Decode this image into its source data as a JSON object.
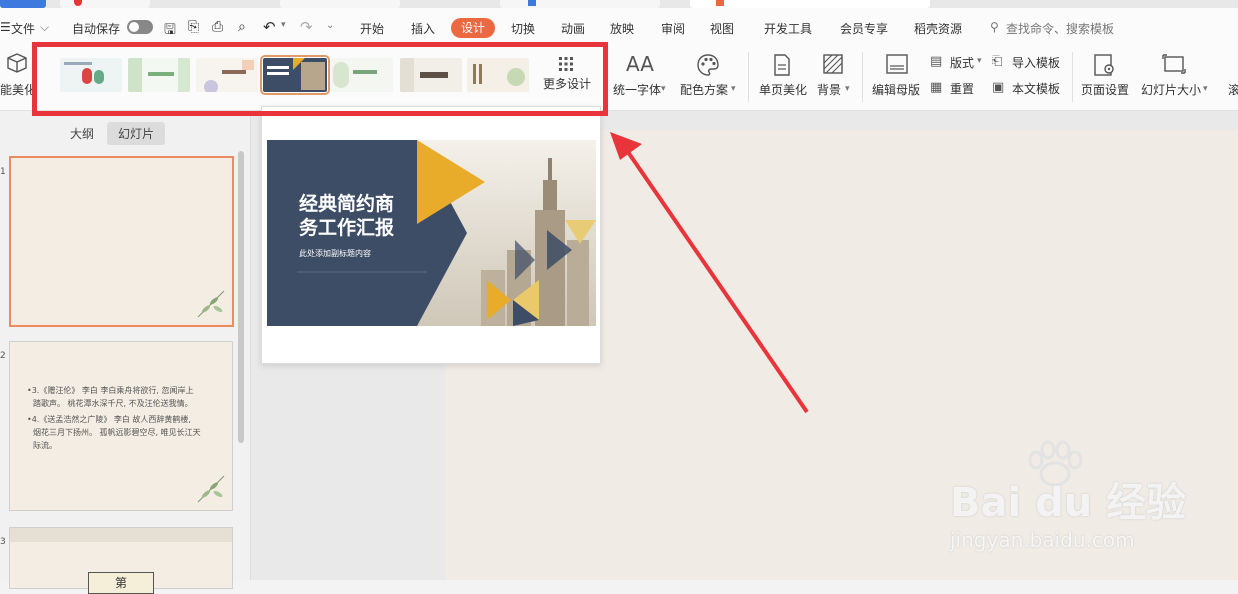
{
  "menu": {
    "file": "文件",
    "autosave": "自动保存",
    "tabs": [
      "开始",
      "插入",
      "设计",
      "切换",
      "动画",
      "放映",
      "审阅",
      "视图",
      "开发工具",
      "会员专享",
      "稻壳资源"
    ],
    "active_tab": "设计",
    "search_placeholder": "查找命令、搜索模板"
  },
  "ribbon": {
    "smart_beautify": "能美化",
    "more_design": "更多设计",
    "unify_font": "统一字体",
    "color_scheme": "配色方案",
    "single_page_beautify": "单页美化",
    "background": "背景",
    "edit_master": "编辑母版",
    "layout": "版式",
    "reset": "重置",
    "import_template": "导入模板",
    "body_template": "本文模板",
    "page_setup": "页面设置",
    "slide_size": "幻灯片大小"
  },
  "left_panel": {
    "tabs": [
      "大纲",
      "幻灯片"
    ],
    "active_tab": "幻灯片",
    "slide2_lines": [
      "•3.《赠汪伦》 李白 李白乘舟将欲行, 忽闻岸上",
      "踏歌声。 桃花潭水深千尺, 不及汪伦送我情。",
      "•4.《送孟浩然之广陵》 李白 故人西辞黄鹤楼,",
      "烟花三月下扬州。 孤帆远影碧空尽, 唯见长江天",
      "际流。"
    ],
    "slide3_text": "第"
  },
  "preview": {
    "title_line1": "经典简约商",
    "title_line2": "务工作汇报",
    "subtitle": "此处添加副标题内容"
  },
  "watermark": {
    "brand": "Bai du 经验",
    "url": "jingyan.baidu.com"
  },
  "colors": {
    "accent": "#ec6841",
    "highlight_box": "#e8343a",
    "preview_navy": "#3d4d66",
    "preview_yellow": "#e9ac2a"
  }
}
